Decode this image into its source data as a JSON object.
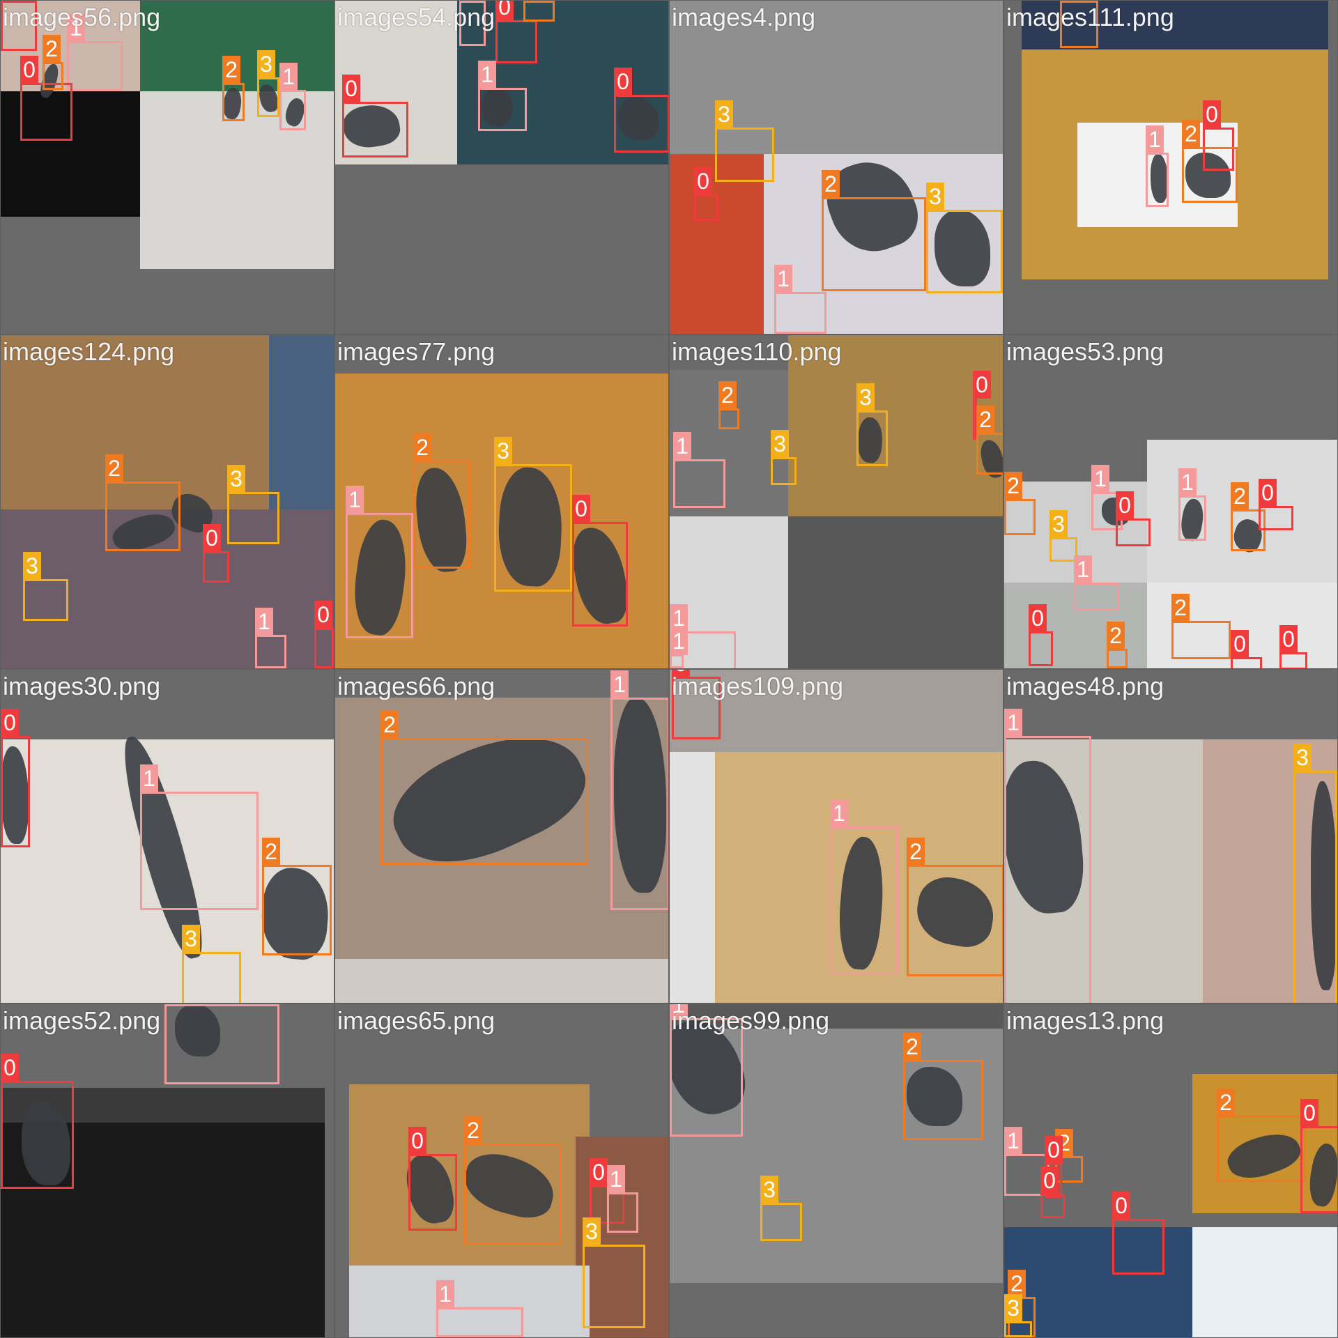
{
  "class_colors": {
    "0": "#ef3b3b",
    "1": "#f49a9a",
    "2": "#f07a22",
    "3": "#f4b01a"
  },
  "tiles": [
    {
      "name": "images56.png",
      "bg": [
        "#cbb7ac",
        "#2f6c4b",
        "#0f0f10",
        "#d9d7d3"
      ],
      "boxes": [
        {
          "c": "0"
        },
        {
          "c": "1"
        },
        {
          "c": "0"
        },
        {
          "c": "2"
        },
        {
          "c": "2"
        },
        {
          "c": "3"
        },
        {
          "c": "1"
        }
      ]
    },
    {
      "name": "images54.png",
      "bg": [
        "#d8d6cf",
        "#2d4b55",
        "#6a6a6a"
      ],
      "boxes": [
        {
          "c": "0"
        },
        {
          "c": "1"
        },
        {
          "c": "0"
        },
        {
          "c": "1"
        },
        {
          "c": "2"
        },
        {
          "c": "0"
        }
      ]
    },
    {
      "name": "images4.png",
      "bg": [
        "#8f8f8f",
        "#c94a2d",
        "#d8d6dc"
      ],
      "boxes": [
        {
          "c": "3"
        },
        {
          "c": "0"
        },
        {
          "c": "2"
        },
        {
          "c": "3"
        },
        {
          "c": "1"
        }
      ]
    },
    {
      "name": "images111.png",
      "bg": [
        "#c7973f",
        "#f2f2f2",
        "#2e3b57"
      ],
      "boxes": [
        {
          "c": "2"
        },
        {
          "c": "0"
        },
        {
          "c": "1"
        },
        {
          "c": "2"
        }
      ]
    },
    {
      "name": "images124.png",
      "bg": [
        "#a0784d",
        "#4a6280",
        "#6c5d68"
      ],
      "boxes": [
        {
          "c": "2"
        },
        {
          "c": "3"
        },
        {
          "c": "0"
        },
        {
          "c": "3"
        },
        {
          "c": "1"
        },
        {
          "c": "0"
        }
      ]
    },
    {
      "name": "images77.png",
      "bg": [
        "#c98a3c",
        "#6a6a6a"
      ],
      "boxes": [
        {
          "c": "2"
        },
        {
          "c": "3"
        },
        {
          "c": "1"
        },
        {
          "c": "0"
        }
      ]
    },
    {
      "name": "images110.png",
      "bg": [
        "#747474",
        "#a98448",
        "#d8d8d8",
        "#575757"
      ],
      "boxes": [
        {
          "c": "2"
        },
        {
          "c": "3"
        },
        {
          "c": "0"
        },
        {
          "c": "2"
        },
        {
          "c": "1"
        },
        {
          "c": "3"
        },
        {
          "c": "1"
        },
        {
          "c": "1"
        }
      ]
    },
    {
      "name": "images53.png",
      "bg": [
        "#6a6a6a",
        "#dcdcdc",
        "#cfcfcf",
        "#b4b6b4",
        "#e6e6e6"
      ],
      "boxes": [
        {
          "c": "1"
        },
        {
          "c": "2"
        },
        {
          "c": "0"
        },
        {
          "c": "2"
        },
        {
          "c": "1"
        },
        {
          "c": "3"
        },
        {
          "c": "0"
        },
        {
          "c": "1"
        },
        {
          "c": "2"
        },
        {
          "c": "0"
        },
        {
          "c": "0"
        },
        {
          "c": "2"
        },
        {
          "c": "0"
        }
      ]
    },
    {
      "name": "images30.png",
      "bg": [
        "#6a6a6a",
        "#e2ddd6"
      ],
      "boxes": [
        {
          "c": "0"
        },
        {
          "c": "1"
        },
        {
          "c": "2"
        },
        {
          "c": "3"
        },
        {
          "c": "1"
        }
      ]
    },
    {
      "name": "images66.png",
      "bg": [
        "#6c6c6c",
        "#a28f7f",
        "#cfcac4"
      ],
      "boxes": [
        {
          "c": "2"
        },
        {
          "c": "1"
        }
      ]
    },
    {
      "name": "images109.png",
      "bg": [
        "#a39e99",
        "#d1b07a",
        "#e2e2e2"
      ],
      "boxes": [
        {
          "c": "0"
        },
        {
          "c": "1"
        },
        {
          "c": "2"
        }
      ]
    },
    {
      "name": "images48.png",
      "bg": [
        "#6a6a6a",
        "#cdc8bf",
        "#c4a59a"
      ],
      "boxes": [
        {
          "c": "1"
        },
        {
          "c": "3"
        }
      ]
    },
    {
      "name": "images52.png",
      "bg": [
        "#6a6a6a",
        "#1a1a1a",
        "#3a3a3a"
      ],
      "boxes": [
        {
          "c": "1"
        },
        {
          "c": "0"
        }
      ]
    },
    {
      "name": "images65.png",
      "bg": [
        "#6a6a6a",
        "#b98d4f",
        "#8c5a44",
        "#d0d2d6"
      ],
      "boxes": [
        {
          "c": "0"
        },
        {
          "c": "2"
        },
        {
          "c": "0"
        },
        {
          "c": "1"
        },
        {
          "c": "3"
        },
        {
          "c": "1"
        }
      ]
    },
    {
      "name": "images99.png",
      "bg": [
        "#595959",
        "#8c8c8c"
      ],
      "boxes": [
        {
          "c": "1"
        },
        {
          "c": "2"
        },
        {
          "c": "3"
        }
      ]
    },
    {
      "name": "images13.png",
      "bg": [
        "#6a6a6a",
        "#c9922f",
        "#2d4a70",
        "#e7eef4"
      ],
      "boxes": [
        {
          "c": "2"
        },
        {
          "c": "0"
        },
        {
          "c": "1"
        },
        {
          "c": "2"
        },
        {
          "c": "0"
        },
        {
          "c": "0"
        },
        {
          "c": "0"
        },
        {
          "c": "2"
        },
        {
          "c": "3"
        }
      ]
    }
  ]
}
